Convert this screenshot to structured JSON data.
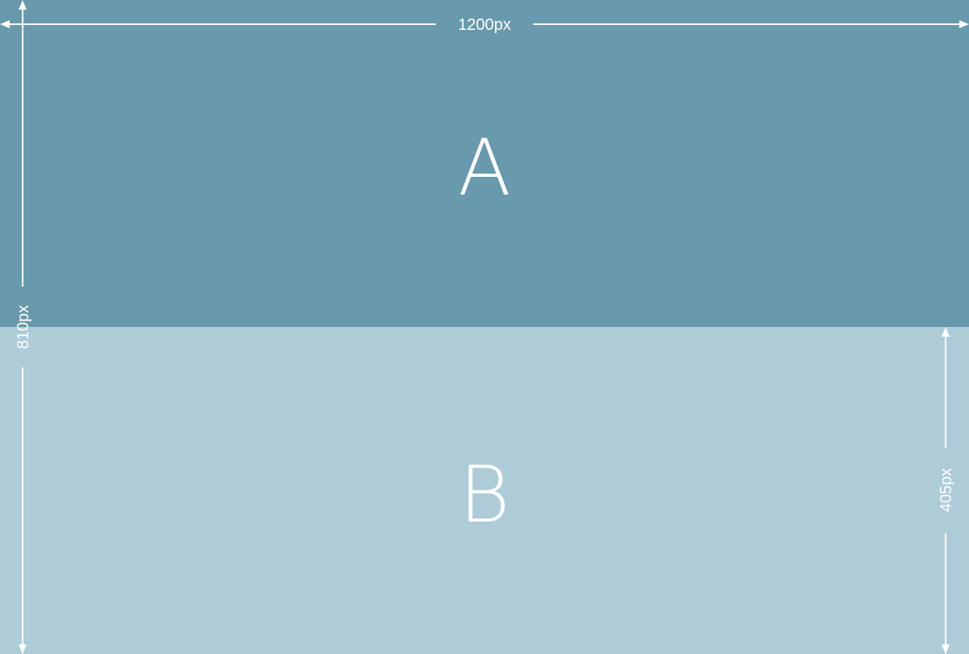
{
  "panels": {
    "a": {
      "label": "A",
      "color": "#6899AC"
    },
    "b": {
      "label": "B",
      "color": "#AECBD8"
    }
  },
  "dimensions": {
    "width_label": "1200px",
    "height_label": "810px",
    "half_height_label": "405px"
  },
  "line_color": "#FFFFFF"
}
